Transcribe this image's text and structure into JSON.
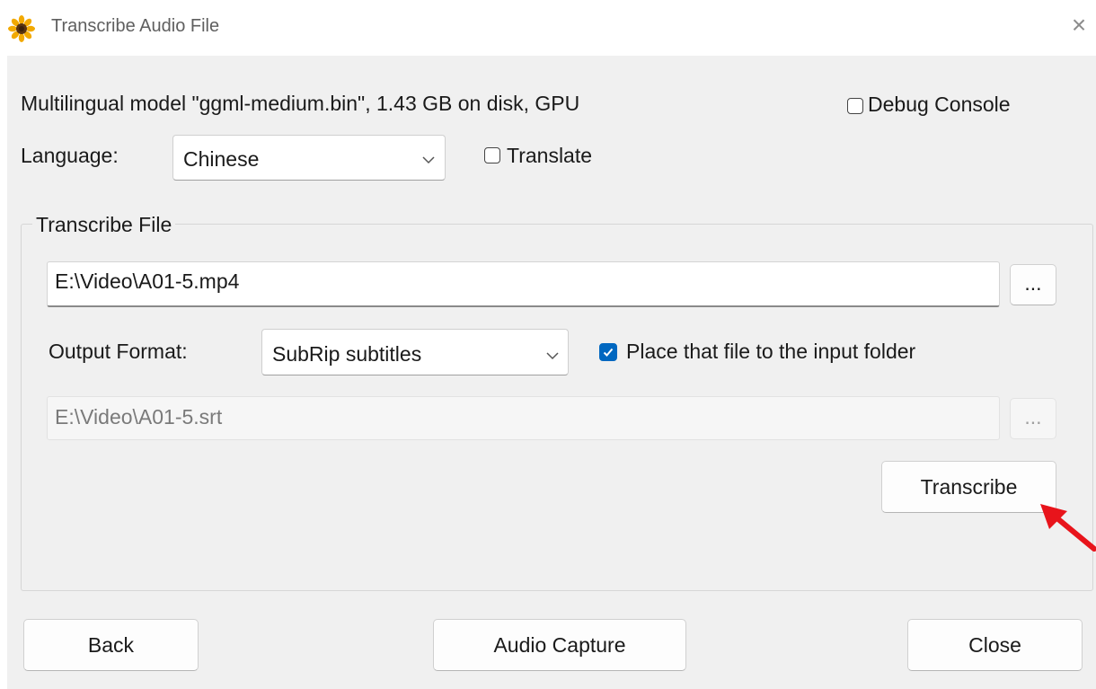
{
  "window": {
    "title": "Transcribe Audio File",
    "close_glyph": "×",
    "app_icon": "sunflower-icon"
  },
  "model_info": "Multilingual model \"ggml-medium.bin\", 1.43 GB on disk, GPU",
  "debug_console": {
    "label": "Debug Console",
    "checked": false
  },
  "language": {
    "label": "Language:",
    "selected": "Chinese"
  },
  "translate": {
    "label": "Translate",
    "checked": false
  },
  "transcribe_file_group": {
    "legend": "Transcribe File",
    "input_path": "E:\\Video\\A01-5.mp4",
    "browse_input_label": "...",
    "output_format_label": "Output Format:",
    "output_format_selected": "SubRip subtitles",
    "place_in_input_folder": {
      "label": "Place that file to the input folder",
      "checked": true
    },
    "output_path": "E:\\Video\\A01-5.srt",
    "browse_output_label": "...",
    "transcribe_button": "Transcribe"
  },
  "footer": {
    "back_button": "Back",
    "audio_capture_button": "Audio Capture",
    "close_button": "Close"
  },
  "colors": {
    "accent": "#0067c0",
    "annotation_arrow": "#e8141b",
    "dialog_background": "#f0f0f0"
  }
}
